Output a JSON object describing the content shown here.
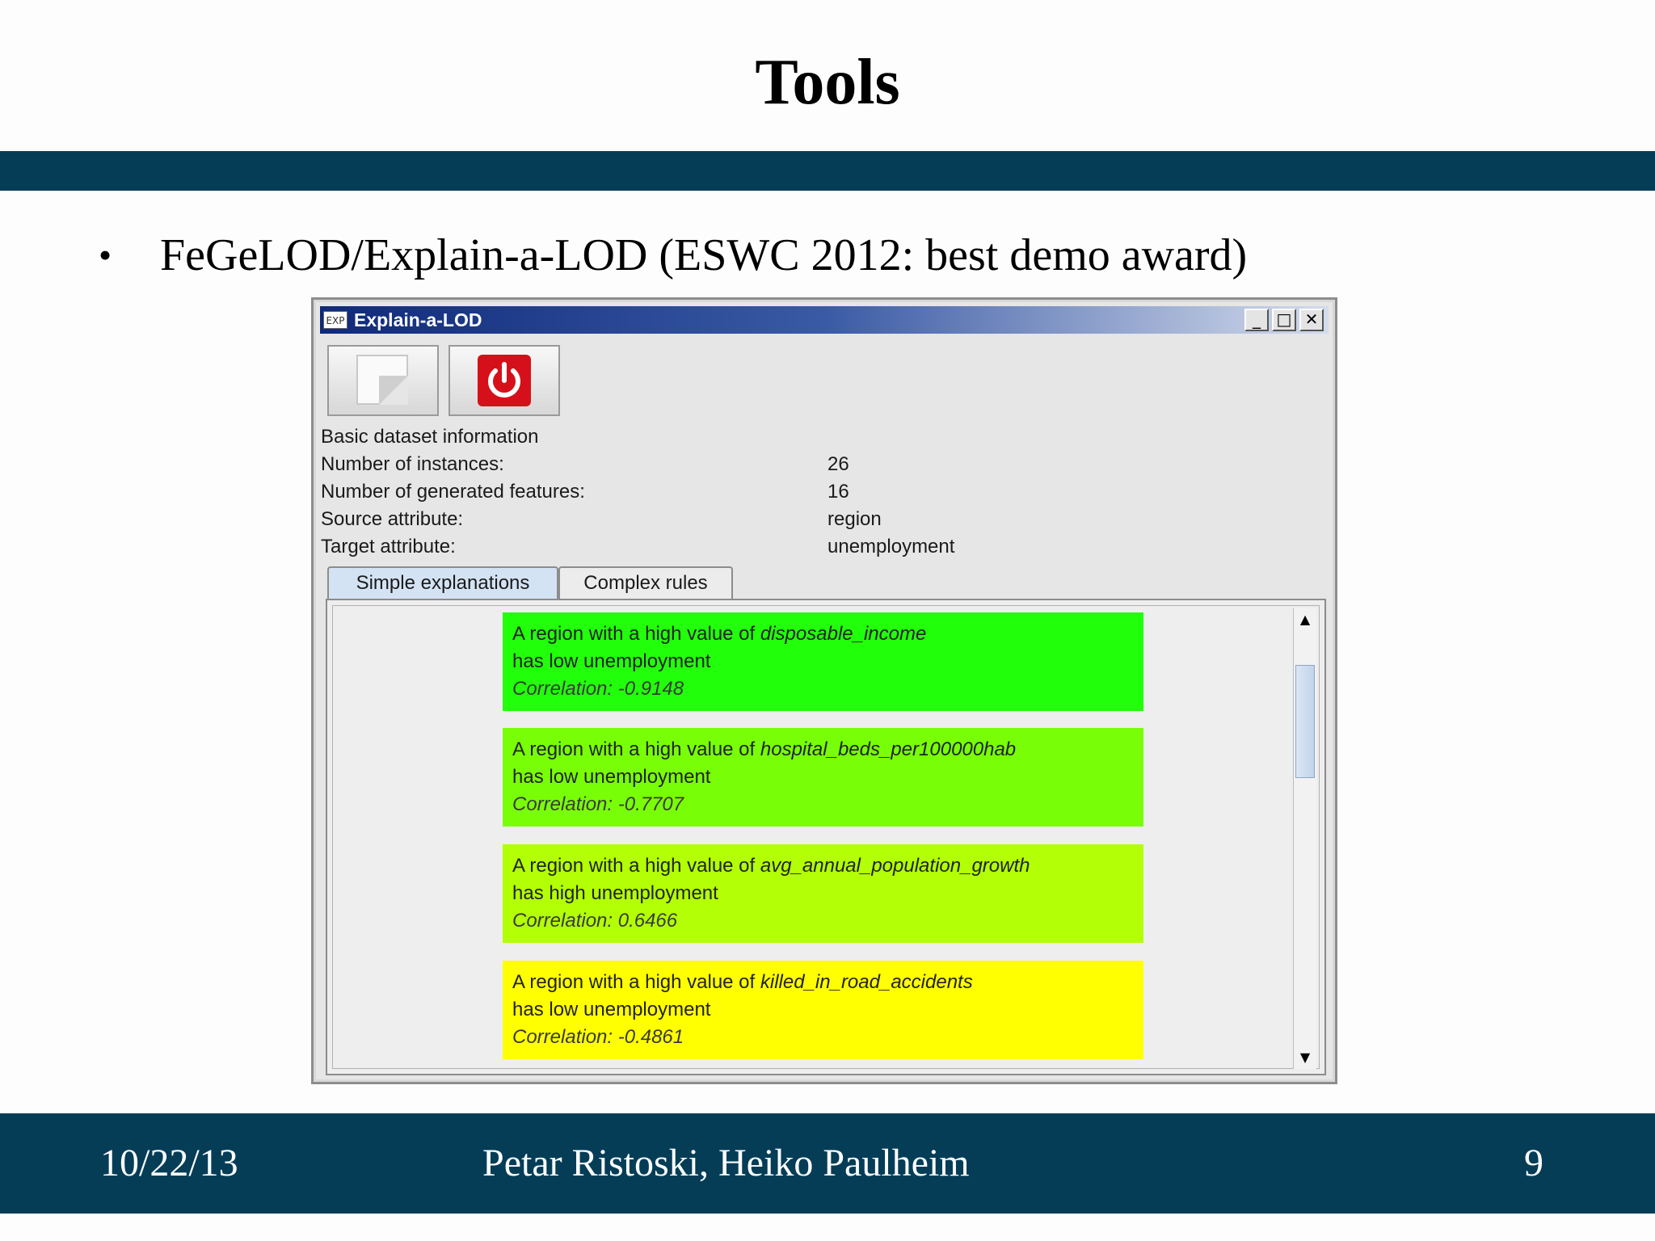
{
  "slide": {
    "title": "Tools",
    "bullet": "FeGeLOD/Explain-a-LOD (ESWC 2012: best demo award)"
  },
  "window": {
    "icon_text": "EXP",
    "title": "Explain-a-LOD",
    "controls": {
      "minimize": "_",
      "maximize": "□",
      "close": "✕"
    }
  },
  "info": {
    "heading": "Basic dataset information",
    "rows": [
      {
        "label": "Number of instances:",
        "value": "26"
      },
      {
        "label": "Number of generated features:",
        "value": "16"
      },
      {
        "label": "Source attribute:",
        "value": "region"
      },
      {
        "label": "Target attribute:",
        "value": "unemployment"
      }
    ]
  },
  "tabs": [
    {
      "label": "Simple explanations",
      "active": true
    },
    {
      "label": "Complex rules",
      "active": false
    }
  ],
  "explanations": [
    {
      "prefix": "A region with a high value of ",
      "feature": "disposable_income",
      "effect": "has low unemployment",
      "correlation": "Correlation: -0.9148",
      "color": "#22ff0a"
    },
    {
      "prefix": "A region with a high value of ",
      "feature": "hospital_beds_per100000hab",
      "effect": "has low unemployment",
      "correlation": "Correlation: -0.7707",
      "color": "#78ff08"
    },
    {
      "prefix": "A region with a high value of ",
      "feature": "avg_annual_population_growth",
      "effect": "has high unemployment",
      "correlation": "Correlation: 0.6466",
      "color": "#b2ff06"
    },
    {
      "prefix": "A region with a high value of ",
      "feature": "killed_in_road_accidents",
      "effect": "has low unemployment",
      "correlation": "Correlation: -0.4861",
      "color": "#ffff02"
    }
  ],
  "scrollbar": {
    "up": "▲",
    "down": "▼"
  },
  "footer": {
    "date": "10/22/13",
    "authors": "Petar Ristoski, Heiko Paulheim",
    "page": "9"
  },
  "colors": {
    "band": "#053d57"
  }
}
